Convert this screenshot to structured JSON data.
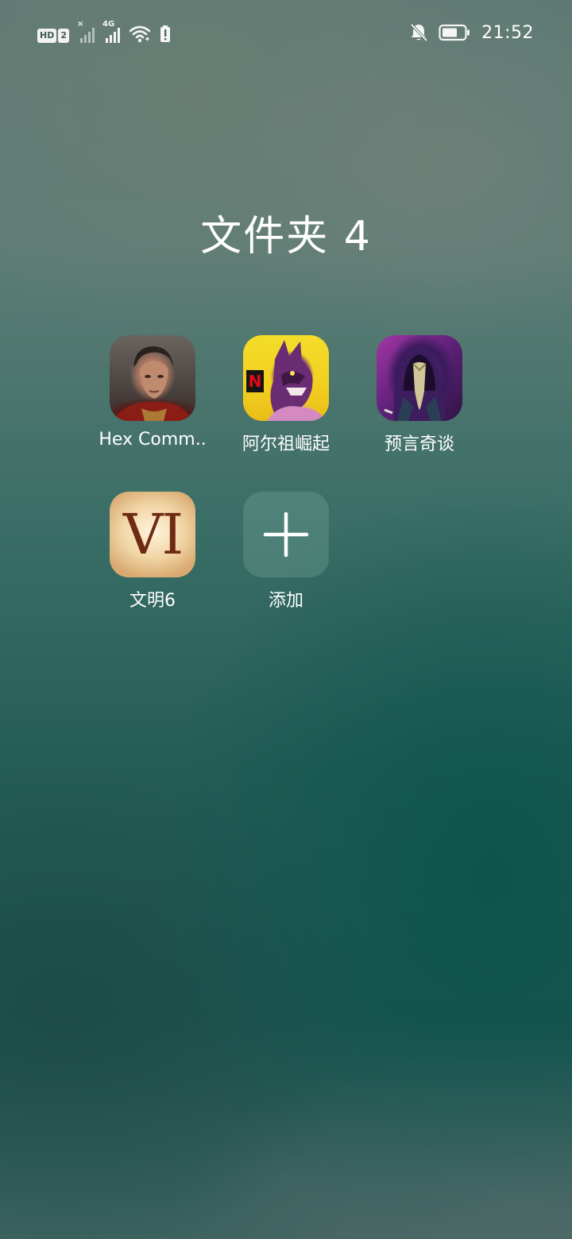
{
  "status_bar": {
    "hd_label": "HD",
    "sim_number": "2",
    "network_type": "4G",
    "time": "21:52",
    "icons": [
      "hd-icon",
      "signal-icon",
      "signal-4g-icon",
      "wifi-icon",
      "battery-alert-icon",
      "bell-muted-icon",
      "battery-icon"
    ]
  },
  "folder": {
    "title": "文件夹 4",
    "apps": [
      {
        "label": "Hex Comm..",
        "icon": "hex-commander-app-icon"
      },
      {
        "label": "阿尔祖崛起",
        "icon": "arzu-rising-app-icon"
      },
      {
        "label": "预言奇谈",
        "icon": "prophecy-tales-app-icon"
      },
      {
        "label": "文明6",
        "icon": "civilization-vi-app-icon",
        "icon_text": "VI"
      },
      {
        "label": "添加",
        "icon": "add-icon"
      }
    ]
  }
}
